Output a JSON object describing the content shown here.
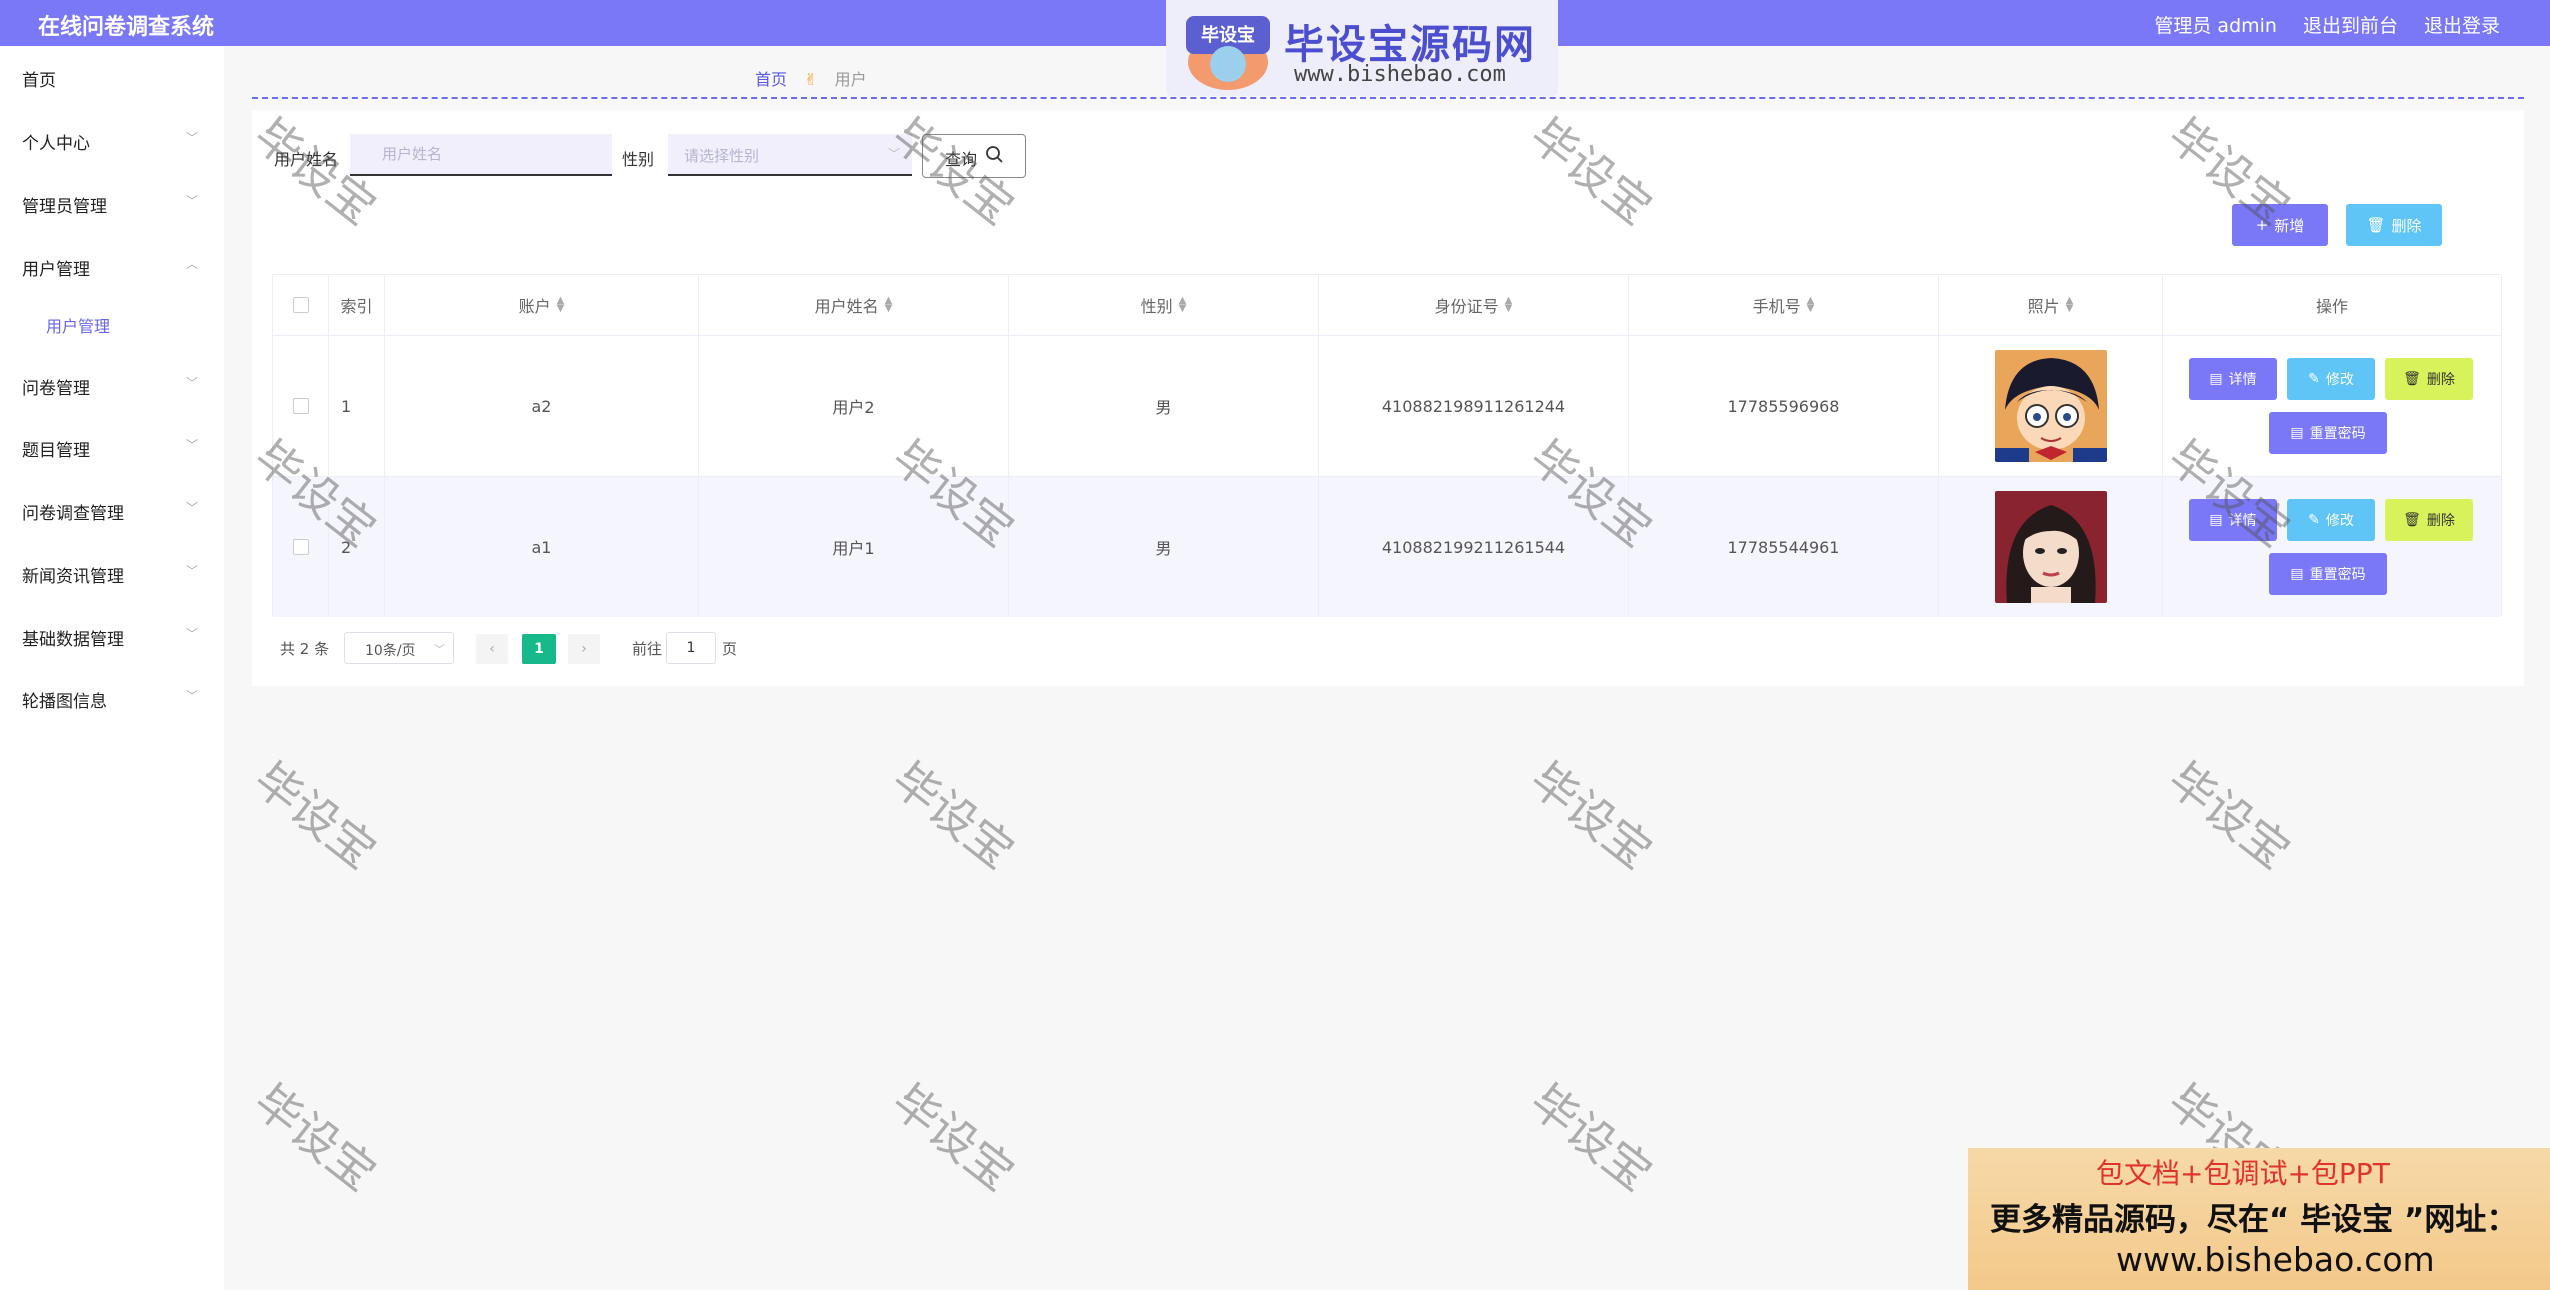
{
  "header": {
    "title": "在线问卷调查系统",
    "admin_label": "管理员 admin",
    "to_front_label": "退出到前台",
    "logout_label": "退出登录"
  },
  "logo": {
    "badge_text": "毕设宝",
    "main_text": "毕设宝源码网",
    "url": "www.bishebao.com"
  },
  "sidebar": {
    "items": [
      {
        "label": "首页"
      },
      {
        "label": "个人中心"
      },
      {
        "label": "管理员管理"
      },
      {
        "label": "用户管理"
      },
      {
        "label": "用户管理"
      },
      {
        "label": "问卷管理"
      },
      {
        "label": "题目管理"
      },
      {
        "label": "问卷调查管理"
      },
      {
        "label": "新闻资讯管理"
      },
      {
        "label": "基础数据管理"
      },
      {
        "label": "轮播图信息"
      }
    ]
  },
  "breadcrumb": {
    "home": "首页",
    "current": "用户"
  },
  "search": {
    "name_label": "用户姓名",
    "name_placeholder": "用户姓名",
    "gender_label": "性别",
    "gender_placeholder": "请选择性别",
    "search_label": "查询"
  },
  "actions": {
    "add_label": "新增",
    "delete_label": "删除"
  },
  "table": {
    "headers": [
      "索引",
      "账户",
      "用户姓名",
      "性别",
      "身份证号",
      "手机号",
      "照片",
      "操作"
    ],
    "rows": [
      {
        "index": "1",
        "account": "a2",
        "name": "用户2",
        "gender": "男",
        "id_card": "410882198911261244",
        "phone": "17785596968"
      },
      {
        "index": "2",
        "account": "a1",
        "name": "用户1",
        "gender": "男",
        "id_card": "410882199211261544",
        "phone": "17785544961"
      }
    ],
    "row_actions": {
      "detail": "详情",
      "edit": "修改",
      "delete": "删除",
      "reset": "重置密码"
    }
  },
  "pagination": {
    "total": "共 2 条",
    "page_size": "10条/页",
    "current_page": "1",
    "goto_label": "前往",
    "goto_value": "1",
    "page_suffix": "页"
  },
  "watermark": "毕设宝",
  "ad": {
    "line1": "包文档+包调试+包PPT",
    "line2": "更多精品源码，尽在“ 毕设宝 ”网址：",
    "line3": "www.bishebao.com"
  },
  "colors": {
    "brand": "#7a78f6",
    "info": "#5fc4f6",
    "warn": "#d8f25c",
    "page_active": "#17b889"
  }
}
